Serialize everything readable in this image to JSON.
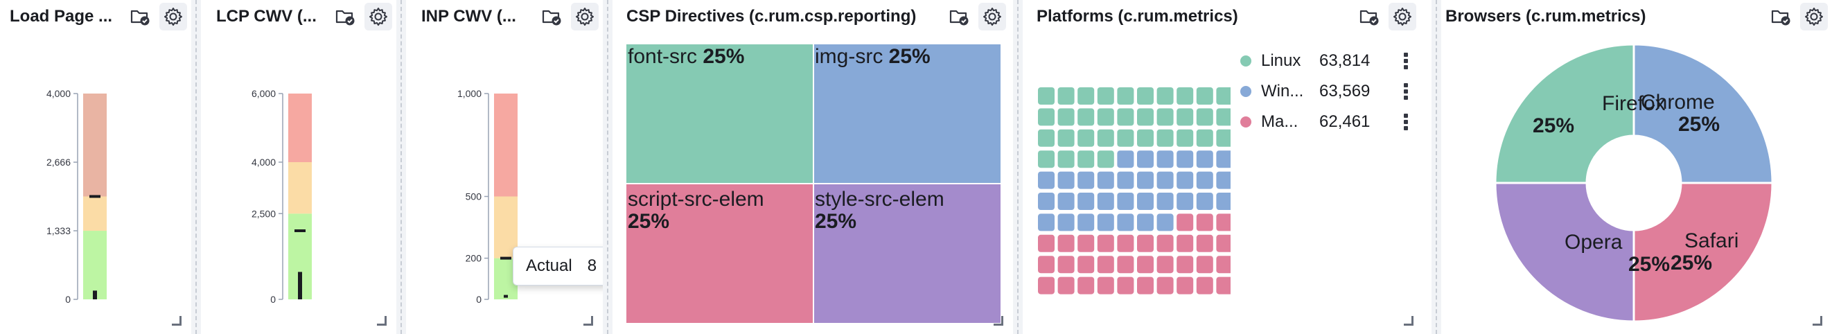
{
  "panels": {
    "load": {
      "title": "Load Page ...",
      "ticks": [
        "4,000",
        "2,666",
        "1,333",
        "0"
      ]
    },
    "lcp": {
      "title": "LCP CWV (...",
      "ticks": [
        "6,000",
        "4,000",
        "2,500",
        "0"
      ]
    },
    "inp": {
      "title": "INP CWV (...",
      "ticks": [
        "1,000",
        "500",
        "200",
        "0"
      ],
      "tooltip": {
        "label": "Actual",
        "value": "8"
      }
    },
    "csp": {
      "title": "CSP Directives (c.rum.csp.reporting)"
    },
    "platforms": {
      "title": "Platforms (c.rum.metrics)"
    },
    "browsers": {
      "title": "Browsers (c.rum.metrics)"
    }
  },
  "colors": {
    "green": "#bdf5a3",
    "yellow": "#fbdca6",
    "red_load": "#e9b4a3",
    "red": "#f6a8a1",
    "teal": "#85cab3",
    "blue": "#87a9d7",
    "pink": "#e07e9a",
    "purple": "#a48bcc"
  },
  "icons": [
    "folder-check-icon",
    "gear-icon",
    "resize-handle-icon",
    "legend-menu-icon"
  ],
  "chart_data": [
    {
      "type": "bar",
      "subtype": "gauge",
      "title": "Load Page ...",
      "ticks": [
        0,
        1333,
        2666,
        4000
      ],
      "bands": [
        {
          "from": 0,
          "to": 1333,
          "color": "green"
        },
        {
          "from": 1333,
          "to": 2000,
          "color": "yellow"
        },
        {
          "from": 2000,
          "to": 4000,
          "color": "red"
        }
      ],
      "goal": 2000,
      "value": 170,
      "ylim": [
        0,
        4000
      ]
    },
    {
      "type": "bar",
      "subtype": "gauge",
      "title": "LCP CWV (...",
      "ticks": [
        0,
        2500,
        4000,
        6000
      ],
      "bands": [
        {
          "from": 0,
          "to": 2500,
          "color": "green"
        },
        {
          "from": 2500,
          "to": 4000,
          "color": "yellow"
        },
        {
          "from": 4000,
          "to": 6000,
          "color": "red"
        }
      ],
      "goal": 2000,
      "value": 800,
      "ylim": [
        0,
        6000
      ]
    },
    {
      "type": "bar",
      "subtype": "gauge",
      "title": "INP CWV (...",
      "ticks": [
        0,
        200,
        500,
        1000
      ],
      "bands": [
        {
          "from": 0,
          "to": 200,
          "color": "green"
        },
        {
          "from": 200,
          "to": 500,
          "color": "yellow"
        },
        {
          "from": 500,
          "to": 1000,
          "color": "red"
        }
      ],
      "goal": 200,
      "value": 8,
      "ylim": [
        0,
        1000
      ]
    },
    {
      "type": "heatmap",
      "subtype": "treemap",
      "title": "CSP Directives (c.rum.csp.reporting)",
      "categories": [
        "font-src",
        "img-src",
        "script-src-elem",
        "style-src-elem"
      ],
      "values": [
        25,
        25,
        25,
        25
      ],
      "labels": [
        "25%",
        "25%",
        "25%",
        "25%"
      ]
    },
    {
      "type": "bar",
      "subtype": "waffle",
      "title": "Platforms (c.rum.metrics)",
      "categories": [
        "Linux",
        "Win...",
        "Ma..."
      ],
      "values": [
        63814,
        63569,
        62461
      ],
      "value_labels": [
        "63,814",
        "63,569",
        "62,461"
      ],
      "legend": "top-right"
    },
    {
      "type": "pie",
      "subtype": "donut",
      "title": "Browsers (c.rum.metrics)",
      "categories": [
        "Chrome",
        "Safari",
        "Opera",
        "Firefox"
      ],
      "values": [
        25,
        25,
        25,
        25
      ],
      "labels": [
        "25%",
        "25%",
        "25%",
        "25%"
      ]
    }
  ]
}
